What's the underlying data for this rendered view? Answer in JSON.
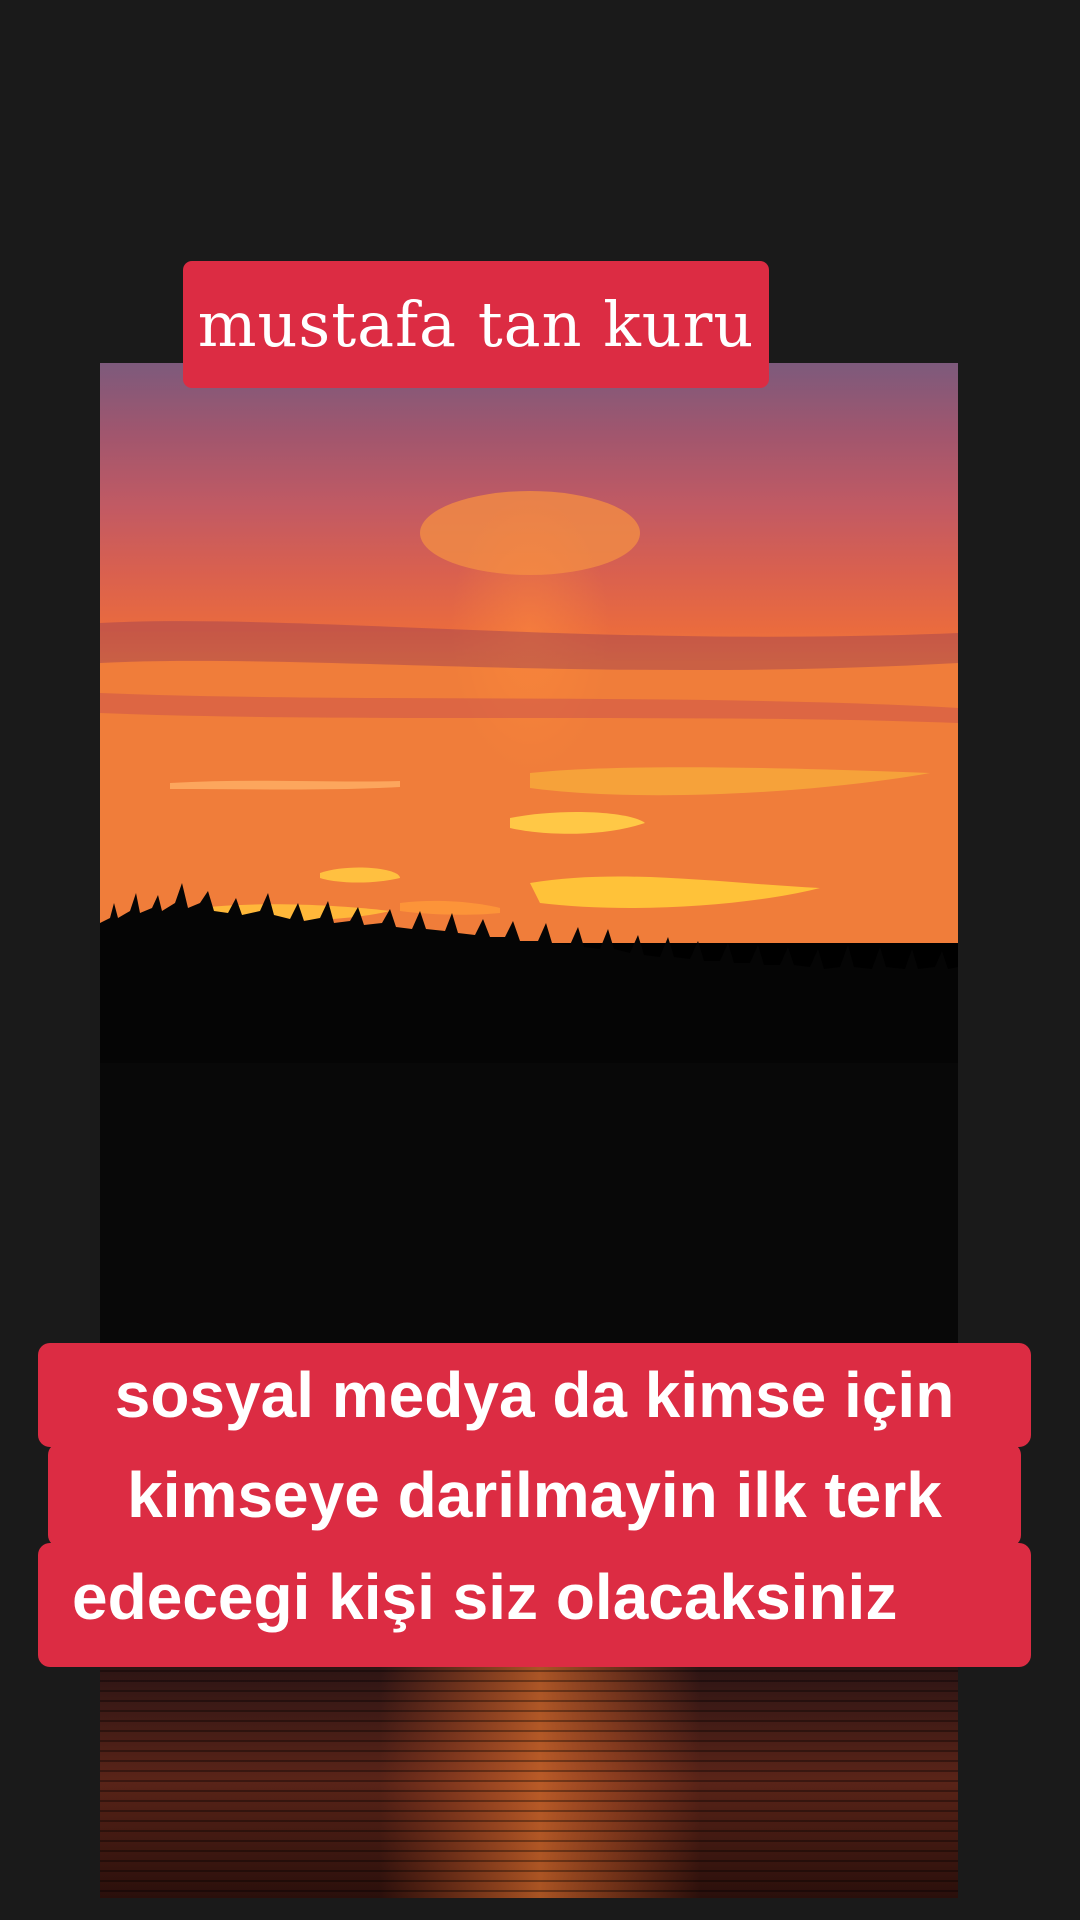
{
  "colors": {
    "background": "#1a1a1a",
    "caption_bg": "#dc2c43",
    "caption_text": "#ffffff"
  },
  "photo": {
    "subject": "sunset over forest and lake"
  },
  "name_caption": {
    "text": "mustafa tan kuru"
  },
  "main_caption": {
    "line1": "sosyal medya da kimse için",
    "line2": "kimseye darilmayin ilk terk",
    "line3": "edecegi kişi siz olacaksiniz"
  }
}
